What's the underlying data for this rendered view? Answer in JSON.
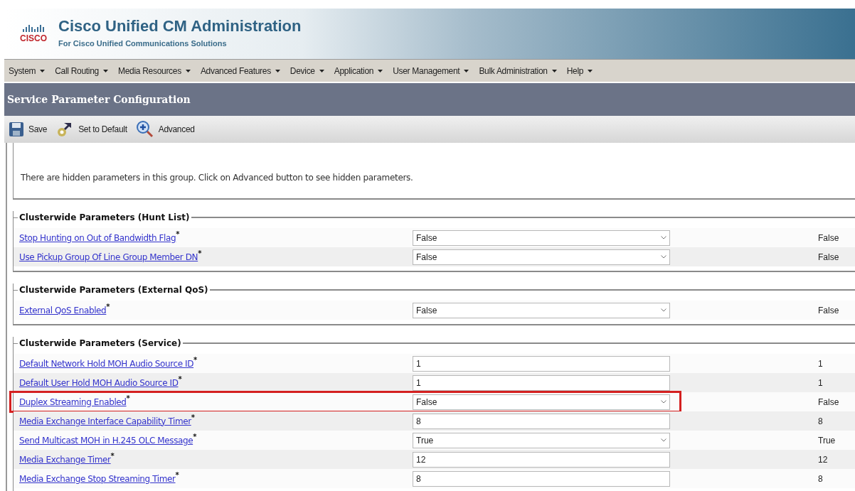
{
  "header": {
    "logo_text": "CISCO",
    "title": "Cisco Unified CM Administration",
    "subtitle": "For Cisco Unified Communications Solutions"
  },
  "menu": [
    "System",
    "Call Routing",
    "Media Resources",
    "Advanced Features",
    "Device",
    "Application",
    "User Management",
    "Bulk Administration",
    "Help"
  ],
  "page_title": "Service Parameter Configuration",
  "toolbar": [
    {
      "kind": "save",
      "label": "Save"
    },
    {
      "kind": "default",
      "label": "Set to Default"
    },
    {
      "kind": "advanced",
      "label": "Advanced"
    }
  ],
  "notice": "There are hidden parameters in this group. Click on Advanced button to see hidden parameters.",
  "groups": [
    {
      "title": "Clusterwide Parameters (Hunt List)",
      "rows": [
        {
          "name": "Stop Hunting on Out of Bandwidth Flag ",
          "marker": "*",
          "kind": "select",
          "value": "False",
          "default": "False",
          "highlighted": false
        },
        {
          "name": "Use Pickup Group Of Line Group Member DN ",
          "marker": "*",
          "kind": "select",
          "value": "False",
          "default": "False",
          "highlighted": false
        }
      ]
    },
    {
      "title": "Clusterwide Parameters (External QoS)",
      "rows": [
        {
          "name": "External QoS Enabled ",
          "marker": "*",
          "kind": "select",
          "value": "False",
          "default": "False",
          "highlighted": false
        }
      ]
    },
    {
      "title": "Clusterwide Parameters (Service)",
      "rows": [
        {
          "name": "Default Network Hold MOH Audio Source ID ",
          "marker": "*",
          "kind": "text",
          "value": "1",
          "default": "1",
          "highlighted": false
        },
        {
          "name": "Default User Hold MOH Audio Source ID ",
          "marker": "*",
          "kind": "text",
          "value": "1",
          "default": "1",
          "highlighted": false
        },
        {
          "name": "Duplex Streaming Enabled ",
          "marker": "*",
          "kind": "select",
          "value": "False",
          "default": "False",
          "highlighted": true
        },
        {
          "name": "Media Exchange Interface Capability Timer ",
          "marker": "*",
          "kind": "text",
          "value": "8",
          "default": "8",
          "highlighted": false
        },
        {
          "name": "Send Multicast MOH in H.245 OLC Message ",
          "marker": "*",
          "kind": "select",
          "value": "True",
          "default": "True",
          "highlighted": false
        },
        {
          "name": "Media Exchange Timer ",
          "marker": "*",
          "kind": "text",
          "value": "12",
          "default": "12",
          "highlighted": false
        },
        {
          "name": "Media Exchange Stop Streaming Timer ",
          "marker": "*",
          "kind": "text",
          "value": "8",
          "default": "8",
          "highlighted": false
        }
      ]
    }
  ]
}
